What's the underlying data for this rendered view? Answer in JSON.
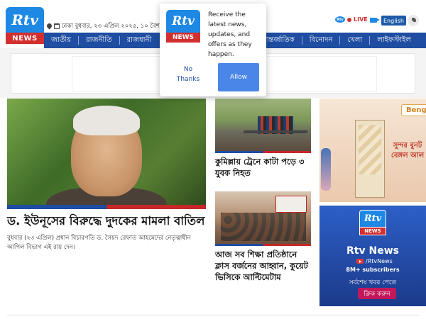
{
  "header": {
    "logo_top": "Rtv",
    "logo_bottom": "NEWS",
    "date_line": "ঢাকা  বুধবার, ২৩ এপ্রিল ২০২৫, ১০ বৈশাখ",
    "live_label": "LIVE",
    "live_logo": "Rtv",
    "english_label": "English"
  },
  "nav": {
    "left_items": [
      "জাতীয়",
      "রাজনীতি",
      "রাজধানী"
    ],
    "right_items": [
      "আন্তর্জাতিক",
      "বিনোদন",
      "খেলা",
      "লাইফস্টাইল"
    ]
  },
  "popup": {
    "logo_top": "Rtv",
    "logo_bottom": "NEWS",
    "message": "Receive the latest news, updates, and offers as they happen.",
    "no_label": "No Thanks",
    "allow_label": "Allow"
  },
  "lead": {
    "title": "ড. ইউনূসের বিরুদ্ধে দুদকের মামলা বাতিল",
    "summary": "বুধবার (২৩ এপ্রিল) প্রধান বিচারপতি ড. সৈয়দ রেফাত আহমেদের নেতৃত্বাধীন আপিল বিভাগ এই রায় দেন।"
  },
  "stories": [
    {
      "title": "কুমিল্লায় ট্রেনে কাটা পড়ে ৩ যুবক নিহত"
    },
    {
      "title": "আজ সব শিক্ষা প্রতিষ্ঠানে ক্লাস বর্জনের আহ্বান, কুয়েট ভিসিকে আল্টিমেটাম"
    }
  ],
  "side_ad1": {
    "brand": "Beng",
    "text": "সুন্দর বুনট বেঙ্গল আল"
  },
  "side_ad2": {
    "logo_top": "Rtv",
    "logo_bottom": "NEWS",
    "title": "Rtv News",
    "youtube_handle": "/RtvNews",
    "subscribers": "8M+ subscribers",
    "tagline": "সর্বশেষ খবর পেতে",
    "button_label": "ক্লিক করুন"
  },
  "colors": {
    "nav_blue": "#1e4da1",
    "brand_red": "#d32f2f",
    "allow_button": "#4a86e8"
  }
}
